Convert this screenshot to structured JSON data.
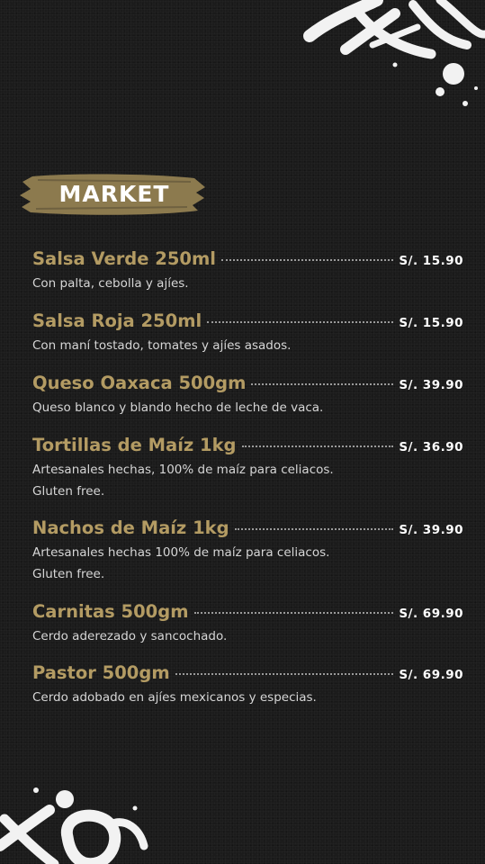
{
  "title": "MARKET",
  "items": [
    {
      "name": "Salsa Verde 250ml",
      "price": "S/. 15.90",
      "desc": [
        "Con palta, cebolla y ajíes."
      ]
    },
    {
      "name": "Salsa Roja 250ml",
      "price": "S/. 15.90",
      "desc": [
        "Con maní tostado, tomates y ajíes asados."
      ]
    },
    {
      "name": "Queso Oaxaca 500gm",
      "price": "S/. 39.90",
      "desc": [
        "Queso blanco y blando hecho de leche de vaca."
      ]
    },
    {
      "name": "Tortillas de Maíz  1kg",
      "price": "S/. 36.90",
      "desc": [
        "Artesanales hechas, 100% de maíz para celiacos.",
        "Gluten free."
      ]
    },
    {
      "name": "Nachos de Maíz 1kg",
      "price": "S/. 39.90",
      "desc": [
        "Artesanales hechas 100% de maíz para celiacos.",
        "Gluten free."
      ]
    },
    {
      "name": "Carnitas 500gm",
      "price": "S/. 69.90",
      "desc": [
        "Cerdo aderezado y sancochado."
      ]
    },
    {
      "name": "Pastor 500gm",
      "price": "S/. 69.90",
      "desc": [
        "Cerdo adobado en ajíes mexicanos y especias."
      ]
    }
  ],
  "colors": {
    "background": "#1b1b1b",
    "gold": "#b39b63",
    "brush": "#8c7a4e",
    "text": "#d6d6d6"
  },
  "icons": {
    "top_decoration": "graffiti-logo-icon",
    "bottom_decoration": "graffiti-logo-icon"
  }
}
